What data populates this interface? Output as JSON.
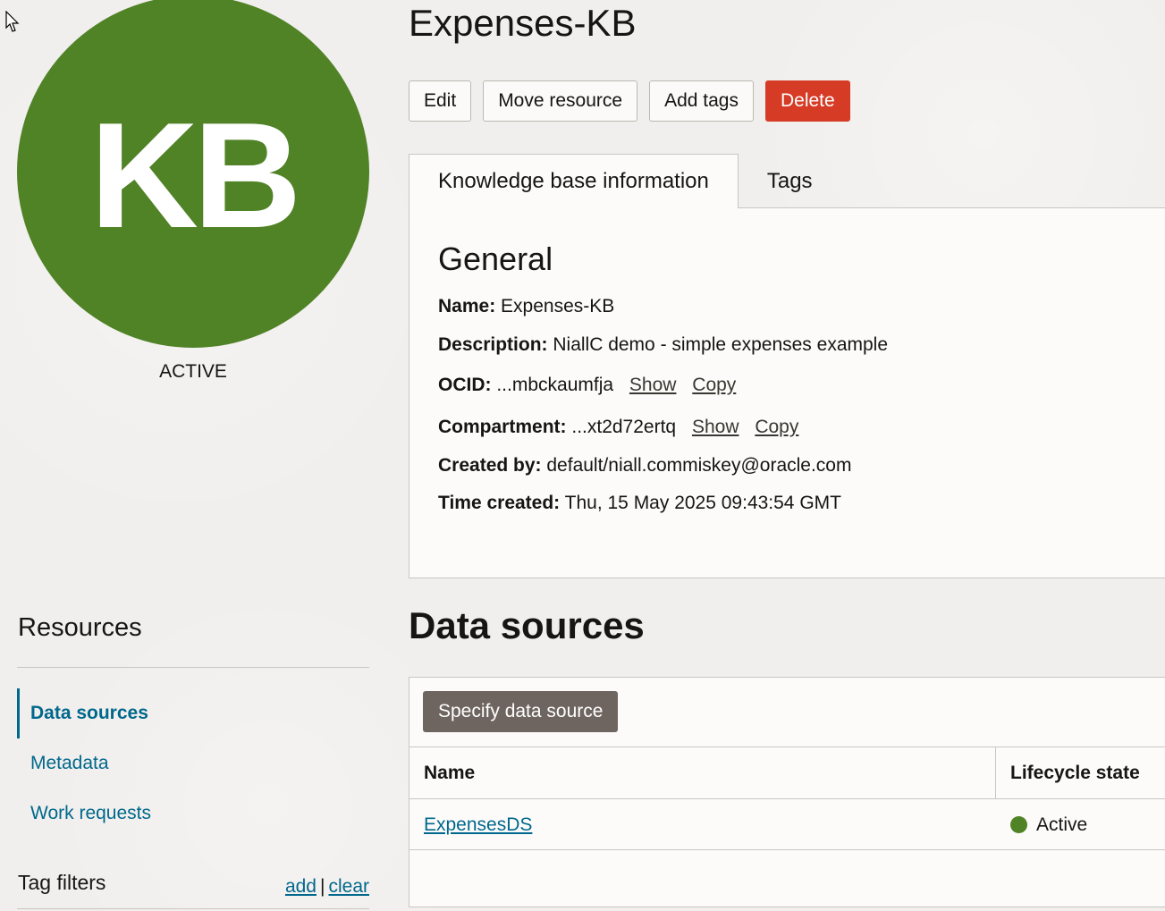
{
  "avatar": {
    "initials": "KB",
    "color": "#508226"
  },
  "status": "ACTIVE",
  "header": {
    "title": "Expenses-KB"
  },
  "actions": {
    "edit": "Edit",
    "move": "Move resource",
    "add_tags": "Add tags",
    "delete": "Delete"
  },
  "tabs": [
    {
      "label": "Knowledge base information",
      "active": true
    },
    {
      "label": "Tags",
      "active": false
    }
  ],
  "general": {
    "title": "General",
    "name": {
      "label": "Name:",
      "value": "Expenses-KB"
    },
    "description": {
      "label": "Description:",
      "value": "NiallC demo - simple expenses example"
    },
    "ocid": {
      "label": "OCID:",
      "value": "...mbckaumfja",
      "show": "Show",
      "copy": "Copy"
    },
    "compartment": {
      "label": "Compartment:",
      "value": "...xt2d72ertq",
      "show": "Show",
      "copy": "Copy"
    },
    "created_by": {
      "label": "Created by:",
      "value": "default/niall.commiskey@oracle.com"
    },
    "time_created": {
      "label": "Time created:",
      "value": "Thu, 15 May 2025 09:43:54 GMT"
    }
  },
  "resources": {
    "title": "Resources",
    "items": [
      {
        "label": "Data sources",
        "active": true
      },
      {
        "label": "Metadata",
        "active": false
      },
      {
        "label": "Work requests",
        "active": false
      }
    ]
  },
  "tag_filters": {
    "title": "Tag filters",
    "add": "add",
    "separator": "|",
    "clear": "clear"
  },
  "data_sources": {
    "title": "Data sources",
    "specify_button": "Specify data source",
    "columns": {
      "name": "Name",
      "state": "Lifecycle state"
    },
    "rows": [
      {
        "name": "ExpensesDS",
        "state": "Active",
        "state_color": "#508226"
      }
    ]
  },
  "colors": {
    "accent": "#00688c",
    "danger": "#d63b25",
    "success": "#508226"
  }
}
